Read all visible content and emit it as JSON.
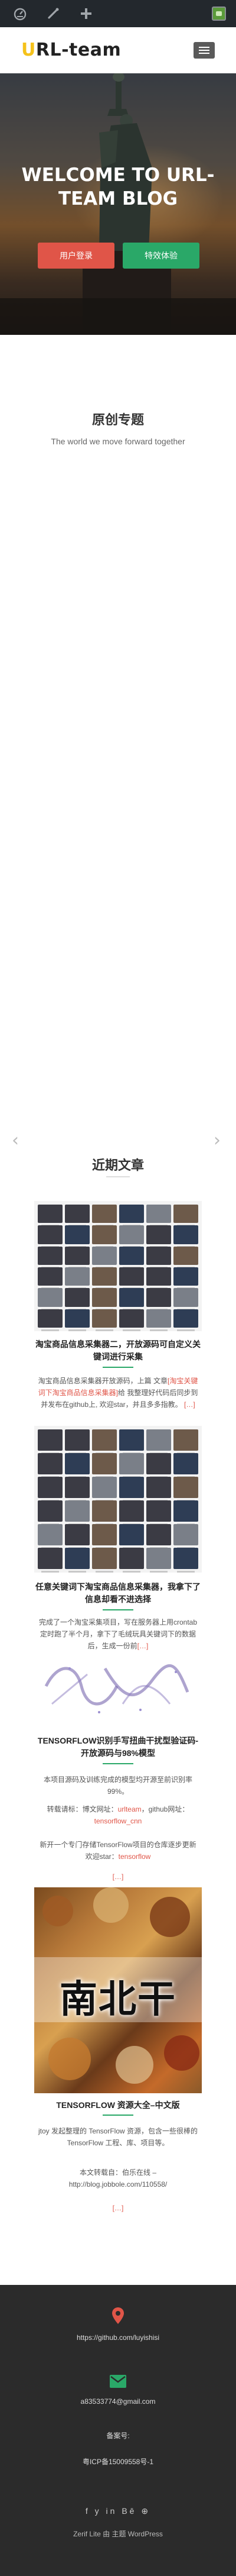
{
  "colors": {
    "accent_red": "#e05548",
    "accent_green": "#2aa868",
    "logo_first": "#f5c21b",
    "admin_bar": "#23282d",
    "footer_bg": "#2b2b2b"
  },
  "header": {
    "logo_first": "U",
    "logo_rest": "RL-team"
  },
  "hero": {
    "title": "WELCOME TO URL-TEAM BLOG",
    "button_left": "用户登录",
    "button_right": "特效体验"
  },
  "originals": {
    "title": "原创专题",
    "subtitle": "The world we move forward together"
  },
  "recent": {
    "title": "近期文章"
  },
  "posts": [
    {
      "title": "淘宝商品信息采集器二，开放源码可自定义关键词进行采集",
      "excerpt_prefix": "淘宝商品信息采集器开放源码，上篇 文章",
      "excerpt_link": "[淘宝关键词下淘宝商品信息采集器]",
      "excerpt_suffix": "给 我整理好代码后同步到并发布在github上, 欢迎star，并且多多指教。",
      "more": "[…]"
    },
    {
      "title": "任意关键词下淘宝商品信息采集器，我拿下了信息却看不进选择",
      "excerpt": "完成了一个淘宝采集项目，写在服务器上用crontab定时跑了半个月，拿下了毛绒玩具关键词下的数据后，生成一份前",
      "more": "[…]"
    },
    {
      "title": "TENSORFLOW识别手写扭曲干扰型验证码-开放源码与98%模型",
      "excerpt_1": "本项目源码及训练完成的模型均开源至前识别率99%。",
      "excerpt_2_prefix": "转载请标：博文网址：",
      "excerpt_2_link1": "urlteam",
      "excerpt_2_mid": "，github网址：",
      "excerpt_2_link2": "tensorflow_cnn",
      "excerpt_3_prefix": "新开一个专门存储TensorFlow项目的仓库逐步更新欢迎star：",
      "excerpt_3_link": "tensorflow",
      "more": "[…]"
    },
    {
      "title": "TENSORFLOW 资源大全–中文版",
      "image_text": "南北干",
      "excerpt": "jtoy 发起整理的 TensorFlow 资源，包含一些很棒的 TensorFlow 工程、库、项目等。",
      "source_label": "本文转载自：伯乐在线 –",
      "source_url": "http://blog.jobbole.com/110558/",
      "more": "[…]"
    }
  ],
  "footer": {
    "github": "https://github.com/luyishisi",
    "email": "a83533774@gmail.com",
    "record_label": "备案号:",
    "record": "粤ICP备15009558号-1",
    "social": "f  y  in  Bē  ⊕",
    "credit": "Zerif Lite 由 主题 WordPress"
  },
  "icons": {
    "admin": [
      "dashboard-icon",
      "customize-icon",
      "new-content-icon",
      "avatar"
    ],
    "footer": [
      "location-icon",
      "email-icon",
      "phone-icon"
    ]
  }
}
